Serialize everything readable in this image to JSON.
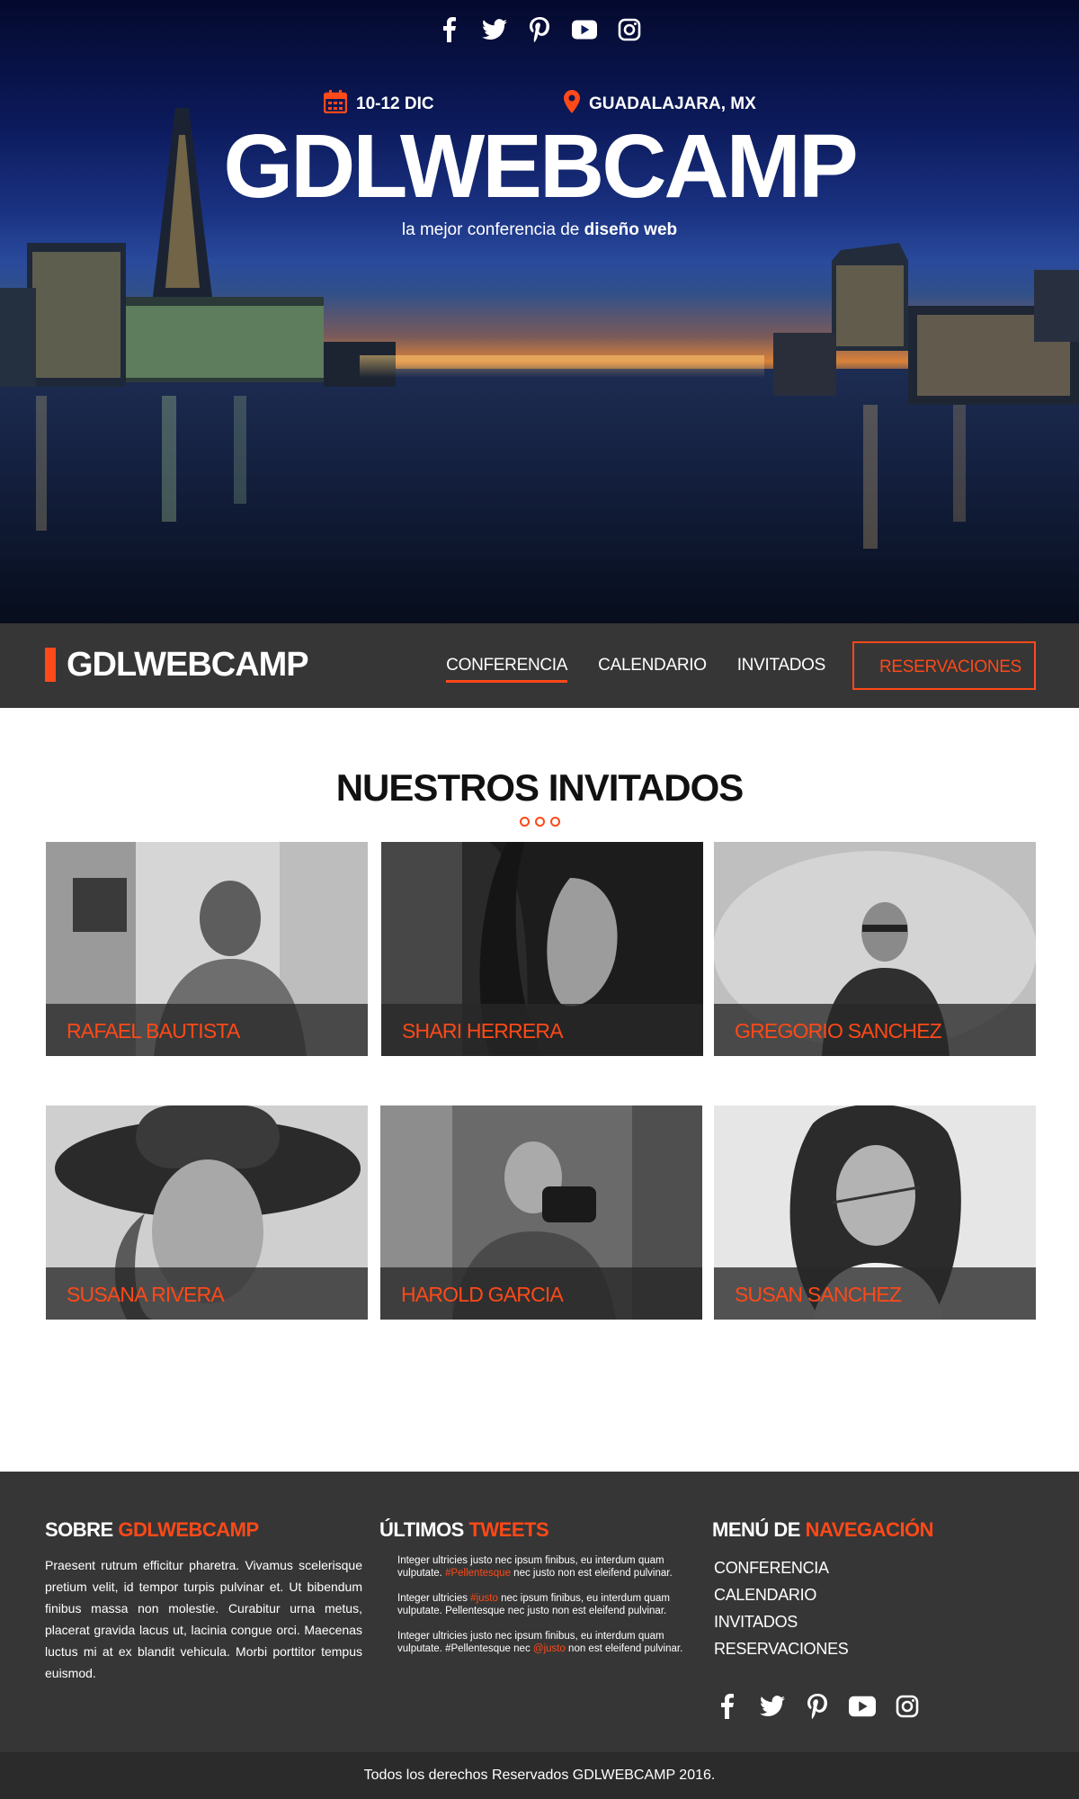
{
  "colors": {
    "accent": "#fe4918",
    "dark": "#363636"
  },
  "hero": {
    "social_icons": [
      "facebook-icon",
      "twitter-icon",
      "pinterest-icon",
      "youtube-icon",
      "instagram-icon"
    ],
    "date": "10-12 DIC",
    "location": "GUADALAJARA, MX",
    "title": "GDLWEBCAMP",
    "tagline_prefix": "la mejor conferencia de ",
    "tagline_bold": "diseño web"
  },
  "navbar": {
    "brand": "GDLWEBCAMP",
    "links": [
      "CONFERENCIA",
      "CALENDARIO",
      "INVITADOS",
      "RESERVACIONES"
    ],
    "active": "CONFERENCIA"
  },
  "guests": {
    "title": "NUESTROS INVITADOS",
    "list": [
      {
        "name": "RAFAEL BAUTISTA"
      },
      {
        "name": "SHARI HERRERA"
      },
      {
        "name": "GREGORIO SANCHEZ"
      },
      {
        "name": "SUSANA RIVERA"
      },
      {
        "name": "HAROLD GARCIA"
      },
      {
        "name": "SUSAN  SANCHEZ"
      }
    ]
  },
  "footer": {
    "about": {
      "title_prefix": "SOBRE ",
      "title_accent": "GDLWEBCAMP",
      "text": "Praesent rutrum efficitur pharetra. Vivamus sceleris­que pretium velit, id tempor turpis pulvinar et. Ut bibendum finibus massa non molestie. Curabitur urna metus, placerat gravida lacus ut, lacinia congue orci. Maecenas luctus mi at ex blandit vehicula. Morbi port­titor tempus euismod."
    },
    "tweets": {
      "title_prefix": "ÚLTIMOS ",
      "title_accent": "TWEETS",
      "items": [
        {
          "before": "Integer ultricies justo nec ipsum finibus, eu interdum quam vulputate. ",
          "tag": "#Pellentesque",
          "after": " nec justo non est eleif­end pulvinar."
        },
        {
          "before": "Integer ultricies ",
          "tag": "#justo",
          "after": " nec ipsum finibus, eu interdum quam vulputate. Pellentesque nec justo non est eleifend pulvinar."
        },
        {
          "before": "Integer ultricies justo nec ipsum finibus, eu interdum quam vulputate. #Pellentesque nec ",
          "tag": "@justo",
          "after": " non est eleifend pulvinar."
        }
      ]
    },
    "menu": {
      "title_prefix": "MENÚ DE ",
      "title_accent": "NAVEGACIÓN",
      "links": [
        "CONFERENCIA",
        "CALENDARIO",
        "INVITADOS",
        "RESERVACIONES"
      ]
    },
    "social_icons": [
      "facebook-icon",
      "twitter-icon",
      "pinterest-icon",
      "youtube-icon",
      "instagram-icon"
    ],
    "copyright": "Todos los derechos Reservados GDLWEBCAMP 2016."
  }
}
